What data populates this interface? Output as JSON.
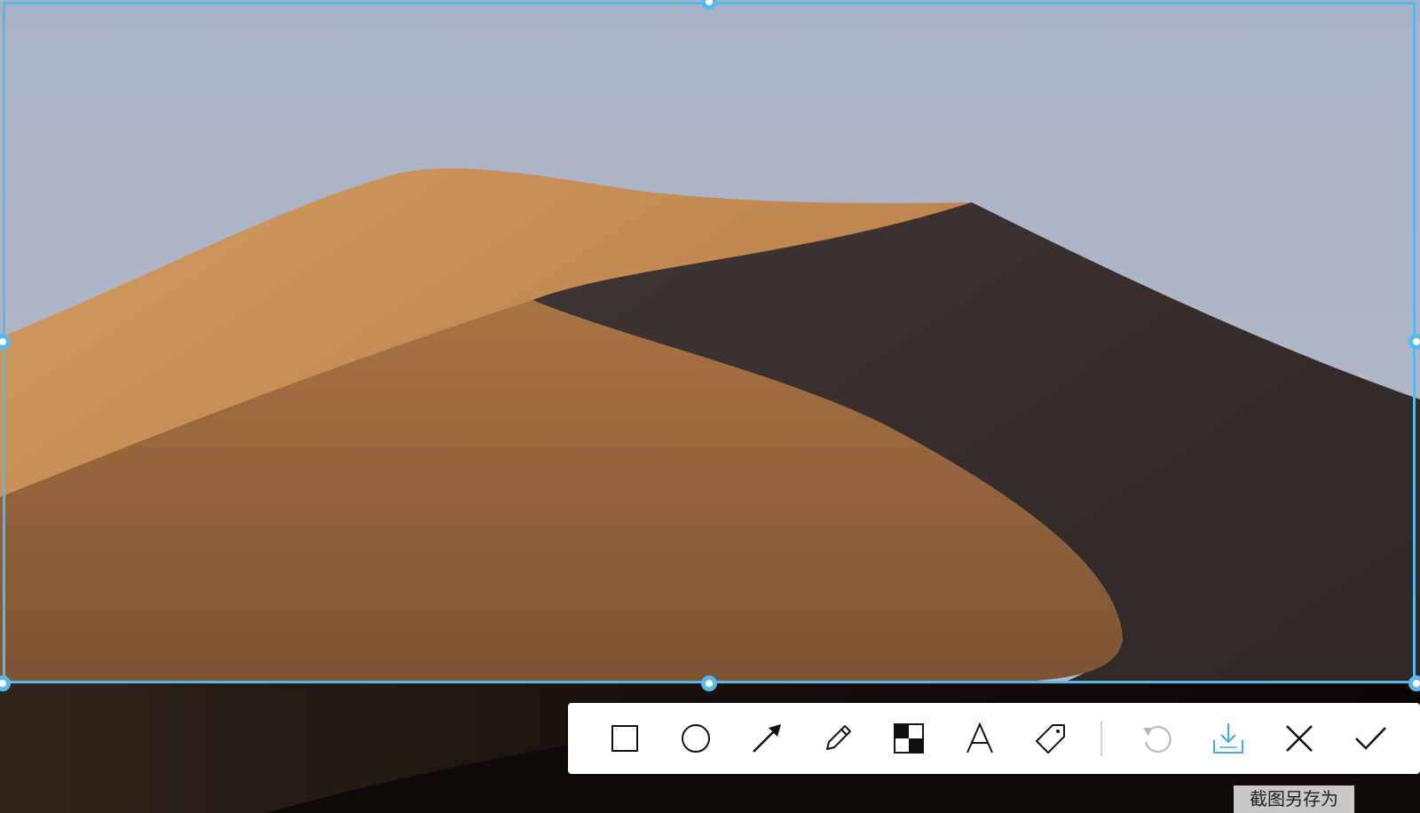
{
  "screenshot_tool": {
    "toolbar": {
      "tools": [
        {
          "name": "rectangle-tool"
        },
        {
          "name": "ellipse-tool"
        },
        {
          "name": "arrow-tool"
        },
        {
          "name": "pencil-tool"
        },
        {
          "name": "mosaic-tool"
        },
        {
          "name": "text-tool"
        },
        {
          "name": "label-tool"
        },
        {
          "name": "undo-button"
        },
        {
          "name": "save-as-button"
        },
        {
          "name": "cancel-button"
        },
        {
          "name": "confirm-button"
        }
      ]
    },
    "tooltip": {
      "save_as": "截图另存为"
    }
  },
  "colors": {
    "selection": "#57b8ec",
    "toolbar_bg": "#ffffff",
    "icon": "#111111",
    "icon_disabled": "#b5b5b5",
    "icon_active": "#4aa8e0",
    "tooltip_bg": "#c8c8c8"
  },
  "icons": [
    "square-icon",
    "circle-icon",
    "arrow-icon",
    "pencil-icon",
    "mosaic-icon",
    "text-icon",
    "tag-icon",
    "undo-icon",
    "download-icon",
    "close-icon",
    "check-icon"
  ]
}
